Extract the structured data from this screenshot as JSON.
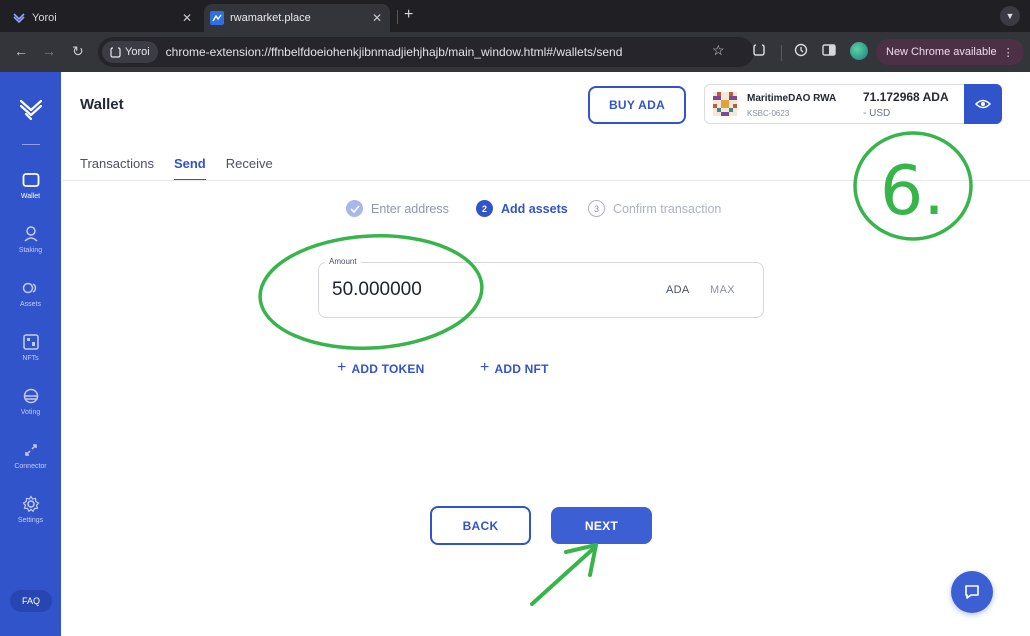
{
  "browser": {
    "tabs": [
      {
        "title": "Yoroi",
        "icon": "yoroi-icon"
      },
      {
        "title": "rwamarket.place",
        "icon": "rwamarket-icon"
      }
    ],
    "site_chip": "Yoroi",
    "url": "chrome-extension://ffnbelfdoeiohenkjibnmadjiehjhajb/main_window.html#/wallets/send",
    "update_label": "New Chrome available"
  },
  "sidebar": {
    "items": [
      {
        "label": "Wallet",
        "icon": "wallet-icon"
      },
      {
        "label": "Staking",
        "icon": "staking-icon"
      },
      {
        "label": "Assets",
        "icon": "assets-icon"
      },
      {
        "label": "NFTs",
        "icon": "nfts-icon"
      },
      {
        "label": "Voting",
        "icon": "voting-icon"
      },
      {
        "label": "Connector",
        "icon": "connector-icon"
      },
      {
        "label": "Settings",
        "icon": "settings-icon"
      }
    ],
    "faq_label": "FAQ"
  },
  "header": {
    "title": "Wallet",
    "buy_label": "BUY ADA",
    "wallet": {
      "name": "MaritimeDAO RWA",
      "plate": "KSBC-0623",
      "balance": "71.172968 ADA",
      "fiat": "- USD"
    }
  },
  "tabs": [
    {
      "label": "Transactions"
    },
    {
      "label": "Send"
    },
    {
      "label": "Receive"
    }
  ],
  "stepper": [
    {
      "label": "Enter address",
      "status": "done"
    },
    {
      "number": "2",
      "label": "Add assets",
      "status": "active"
    },
    {
      "number": "3",
      "label": "Confirm transaction",
      "status": "pending"
    }
  ],
  "amount": {
    "label": "Amount",
    "value": "50.000000",
    "unit": "ADA",
    "max_label": "MAX"
  },
  "add_token_label": "ADD TOKEN",
  "add_nft_label": "ADD NFT",
  "buttons": {
    "back": "BACK",
    "next": "NEXT"
  },
  "annotation": {
    "step_number": "6.",
    "color": "#38b54a"
  },
  "colors": {
    "brand": "#3154cb",
    "text": "#242838"
  }
}
